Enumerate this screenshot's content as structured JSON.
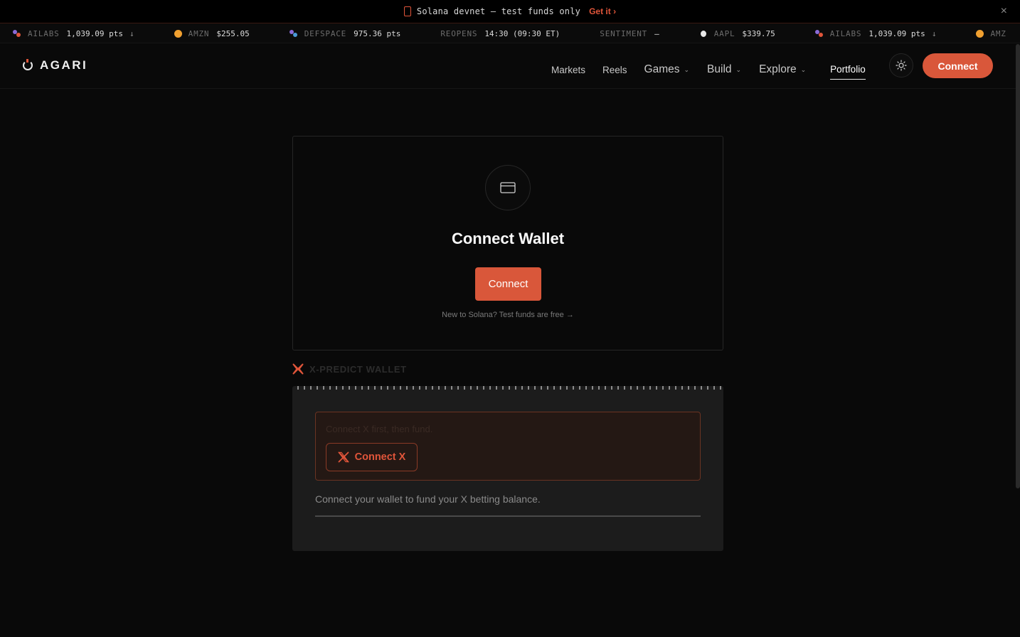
{
  "announcement": {
    "text": "Solana devnet — test funds only",
    "link_label": "Get it",
    "link_chevron": "›",
    "close_glyph": "×",
    "icon": "phone-icon"
  },
  "ticker": [
    {
      "symbol": "AILABS",
      "value": "1,039.09 pts",
      "arrow": "↓",
      "icon": "multicolor-dots-icon"
    },
    {
      "symbol": "AMZN",
      "value": "$255.05",
      "arrow": "",
      "icon": "amazon-coin-icon"
    },
    {
      "symbol": "DEFSPACE",
      "value": "975.36 pts",
      "arrow": "",
      "icon": "multicolor-dots-icon"
    },
    {
      "symbol": "REOPENS",
      "value": "14:30 (09:30 ET)",
      "arrow": ""
    },
    {
      "symbol": "SENTIMENT",
      "value": "—",
      "arrow": ""
    },
    {
      "symbol": "AAPL",
      "value": "$339.75",
      "arrow": "",
      "icon": "apple-icon"
    },
    {
      "symbol": "AILABS",
      "value": "1,039.09 pts",
      "arrow": "↓",
      "icon": "multicolor-dots-icon"
    },
    {
      "symbol": "AMZ",
      "value": "",
      "arrow": "",
      "icon": "amazon-coin-icon"
    }
  ],
  "header": {
    "brand": "AGARI",
    "nav": [
      {
        "label": "Markets",
        "dropdown": false
      },
      {
        "label": "Reels",
        "dropdown": false
      },
      {
        "label": "Games",
        "dropdown": true
      },
      {
        "label": "Build",
        "dropdown": true
      },
      {
        "label": "Explore",
        "dropdown": true
      },
      {
        "label": "Portfolio",
        "dropdown": false,
        "active": true
      }
    ],
    "chevron": "⌄",
    "connect_label": "Connect"
  },
  "wallet_card": {
    "title": "Connect Wallet",
    "button_label": "Connect",
    "subtext": "New to Solana? Test funds are free →"
  },
  "x_predict": {
    "title": "X-PREDICT WALLET",
    "alert_text": "Connect X first, then fund.",
    "connect_x_label": "Connect X",
    "fund_text": "Connect your wallet to fund your X betting balance."
  },
  "colors": {
    "accent": "#d9573a",
    "background": "#090909",
    "panel": "#1c1c1c"
  }
}
